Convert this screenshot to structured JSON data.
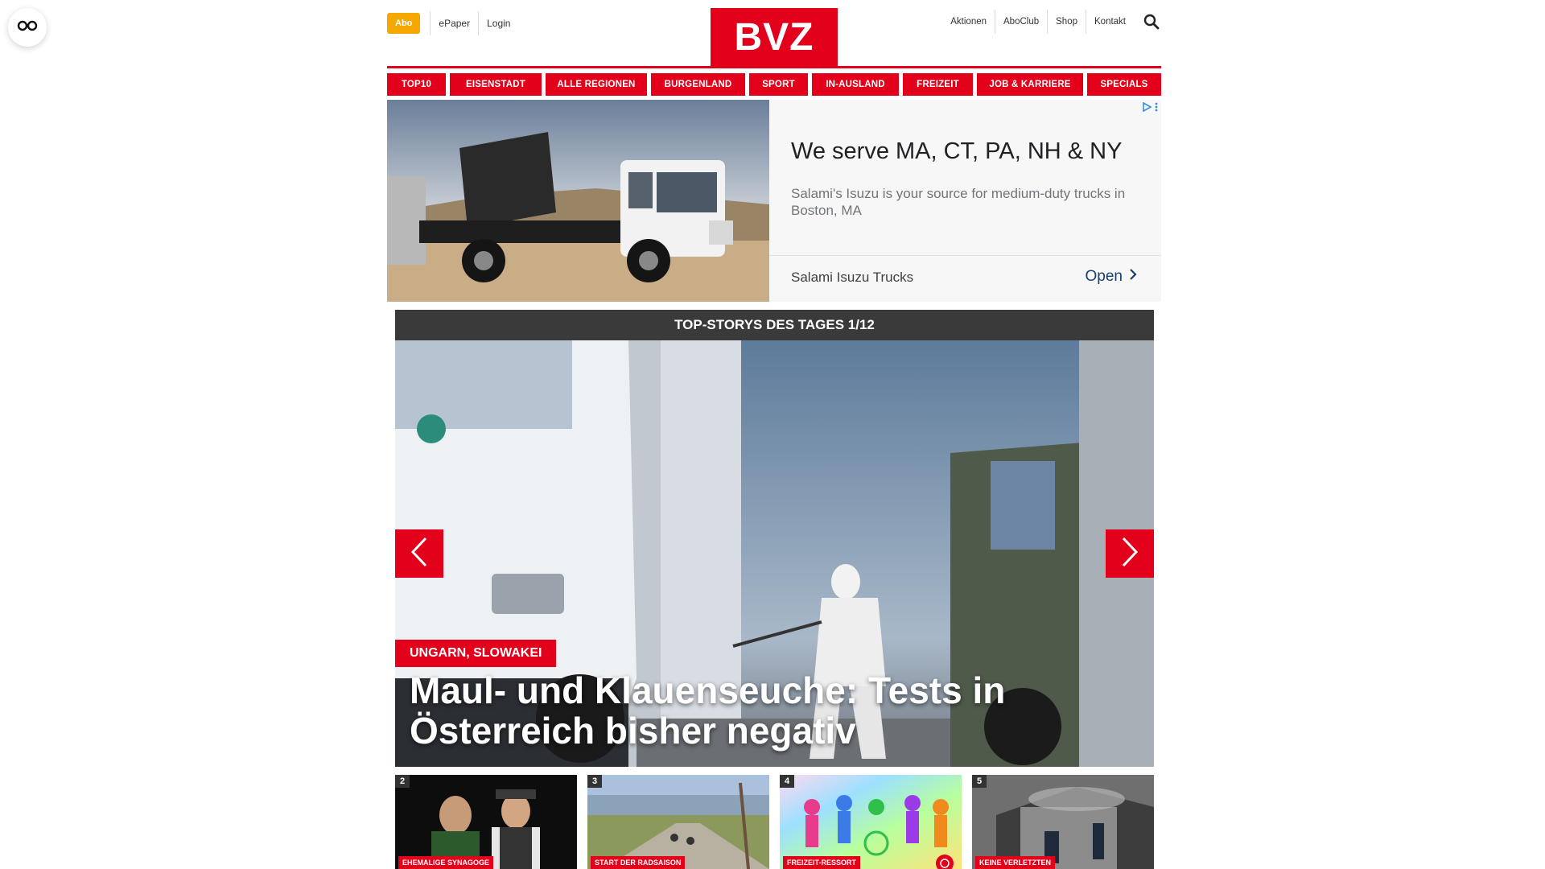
{
  "header": {
    "abo_label": "Abo",
    "epaper_label": "ePaper",
    "login_label": "Login",
    "logo_text": "BVZ",
    "right_links": [
      "Aktionen",
      "AboClub",
      "Shop",
      "Kontakt"
    ]
  },
  "nav": {
    "items": [
      "TOP10",
      "EISENSTADT",
      "ALLE REGIONEN",
      "BURGENLAND",
      "SPORT",
      "IN-AUSLAND",
      "FREIZEIT",
      "JOB & KARRIERE",
      "SPECIALS"
    ]
  },
  "ad": {
    "headline": "We serve MA, CT, PA, NH & NY",
    "description": "Salami's Isuzu is your source for medium-duty trucks in Boston, MA",
    "advertiser": "Salami Isuzu Trucks",
    "cta": "Open"
  },
  "top_stories": {
    "title": "TOP-STORYS DES TAGES 1/12",
    "hero": {
      "tag": "UNGARN, SLOWAKEI",
      "title": "Maul- und Klauenseuche: Tests in Österreich bisher negativ"
    },
    "thumbs": [
      {
        "num": "2",
        "tag": "EHEMALIGE SYNAGOGE"
      },
      {
        "num": "3",
        "tag": "START DER RADSAISON"
      },
      {
        "num": "4",
        "tag": "FREIZEIT-RESSORT"
      },
      {
        "num": "5",
        "tag": "KEINE VERLETZTEN"
      }
    ]
  },
  "colors": {
    "brand_red": "#e2001a",
    "abo_yellow": "#f5a800",
    "bar_dark": "#3a3a3a"
  }
}
